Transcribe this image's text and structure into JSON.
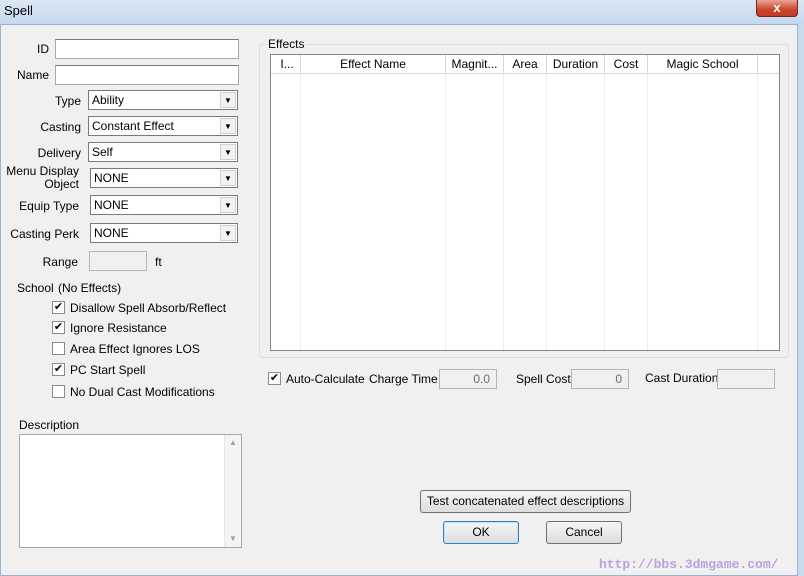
{
  "window": {
    "title": "Spell",
    "close_glyph": "x"
  },
  "form": {
    "id": {
      "label": "ID",
      "value": ""
    },
    "name": {
      "label": "Name",
      "value": ""
    },
    "type": {
      "label": "Type",
      "value": "Ability"
    },
    "casting": {
      "label": "Casting",
      "value": "Constant Effect"
    },
    "delivery": {
      "label": "Delivery",
      "value": "Self"
    },
    "menu_display": {
      "label_line1": "Menu Display",
      "label_line2": "Object",
      "value": "NONE"
    },
    "equip_type": {
      "label": "Equip Type",
      "value": "NONE"
    },
    "casting_perk": {
      "label": "Casting Perk",
      "value": "NONE"
    },
    "range": {
      "label": "Range",
      "value": "",
      "unit": "ft"
    },
    "school": {
      "label": "School",
      "value": "(No Effects)"
    },
    "checkboxes": [
      {
        "label": "Disallow Spell Absorb/Reflect",
        "checked": true
      },
      {
        "label": "Ignore Resistance",
        "checked": true
      },
      {
        "label": "Area Effect Ignores LOS",
        "checked": false
      },
      {
        "label": "PC Start Spell",
        "checked": true
      },
      {
        "label": "No Dual Cast Modifications",
        "checked": false
      }
    ],
    "description": {
      "label": "Description",
      "value": ""
    }
  },
  "effects": {
    "group_label": "Effects",
    "columns": [
      "I...",
      "Effect Name",
      "Magnit...",
      "Area",
      "Duration",
      "Cost",
      "Magic School"
    ]
  },
  "calc": {
    "auto_calculate": {
      "label": "Auto-Calculate",
      "checked": true
    },
    "charge_time": {
      "label": "Charge Time",
      "value": "0.0"
    },
    "spell_cost": {
      "label": "Spell Cost",
      "value": "0"
    },
    "cast_duration": {
      "label": "Cast Duration",
      "value": ""
    }
  },
  "buttons": {
    "test_desc": "Test concatenated effect descriptions",
    "ok": "OK",
    "cancel": "Cancel"
  },
  "watermark": "http://bbs.3dmgame.com/",
  "glyphs": {
    "check": "✔",
    "arrow_down": "▼",
    "arrow_up": "▲"
  }
}
